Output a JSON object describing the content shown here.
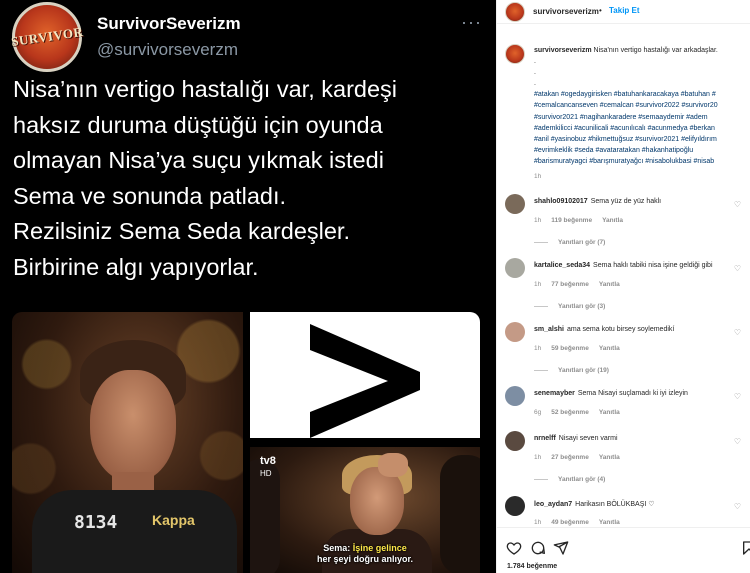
{
  "tweet": {
    "avatar_text": "SURVIVOR",
    "name": "SurvivorSeverizm",
    "handle": "@survivorseverzm",
    "more": "···",
    "lines": [
      "Nisa’nın vertigo hastalığı var, kardeşi",
      "haksız duruma düştüğü için oyunda",
      "olmayan Nisa’ya suçu yıkmak istedi",
      "Sema ve sonunda patladı.",
      "Rezilsiniz Sema Seda kardeşler.",
      "Birbirine algı yapıyorlar."
    ],
    "photo_left": {
      "shirt_number": "8134",
      "shirt_brand": "Kappa"
    },
    "photo_right_bottom": {
      "logo": "tv8",
      "logo_sub": "HD",
      "caption_speaker": "Sema:",
      "caption_highlight": "İşine gelince",
      "caption_line2": "her şeyi doğru anlıyor."
    }
  },
  "instagram": {
    "header": {
      "username": "survivorseverizm",
      "dot": "•",
      "follow": "Takip Et"
    },
    "caption": {
      "username": "survivorseverizm",
      "text": "Nisa'nın vertigo hastalığı var arkadaşlar.",
      "dots": [
        ".",
        ".",
        "."
      ],
      "hashtag_lines": [
        "#atakan #ogedaygirisken #batuhankaracakaya #batuhan #",
        "#cemalcancanseven #cemalcan #survivor2022 #survivor20",
        "#survivor2021 #nagihankaradere #semaaydemir #adem",
        "#ademkilicci #acunilicali #acunılıcalı #acunmedya #berkan",
        "#anil #yasinobuz #hikmettuğsuz #survivor2021 #elifyıldırım",
        "#evrimkeklik #seda #avataratakan #hakanhatipoğlu",
        "#barismuratyagci #barışmuratyağcı #nisabolukbasi #nisab"
      ],
      "time": "1h"
    },
    "comments": [
      {
        "user": "shahlo09102017",
        "text": "Sema yüz de yüz haklı",
        "time": "1h",
        "likes": "119 beğenme",
        "reply": "Yanıtla",
        "replies": "Yanıtları gör (7)",
        "avatar_color": "#7a6a5a"
      },
      {
        "user": "kartalice_seda34",
        "text": "Sema haklı tabiki nisa işine geldiği gibi",
        "time": "1h",
        "likes": "77 beğenme",
        "reply": "Yanıtla",
        "replies": "Yanıtları gör (3)",
        "avatar_color": "#a8a8a0"
      },
      {
        "user": "sm_alshi",
        "text": "ama sema kotu birsey soylemedikí",
        "time": "1h",
        "likes": "59 beğenme",
        "reply": "Yanıtla",
        "replies": "Yanıtları gör (19)",
        "avatar_color": "#c49a86"
      },
      {
        "user": "senemayber",
        "text": "Sema Nisayi suçlamadı ki iyi izleyin",
        "time": "6g",
        "likes": "52 beğenme",
        "reply": "Yanıtla",
        "replies": "",
        "avatar_color": "#7d8ea3"
      },
      {
        "user": "nrnelff",
        "text": "Nisayi seven varmi",
        "time": "1h",
        "likes": "27 beğenme",
        "reply": "Yanıtla",
        "replies": "Yanıtları gör (4)",
        "avatar_color": "#5a4a40"
      },
      {
        "user": "leo_aydan7",
        "text": "Harikasın BÖLÜKBAŞI ♡",
        "time": "1h",
        "likes": "49 beğenme",
        "reply": "Yanıtla",
        "replies": "",
        "avatar_color": "#2a2a2a"
      }
    ],
    "likes_total": "1.784 beğenme",
    "icons": [
      "heart-icon",
      "comment-icon",
      "share-icon",
      "bookmark-icon"
    ]
  }
}
